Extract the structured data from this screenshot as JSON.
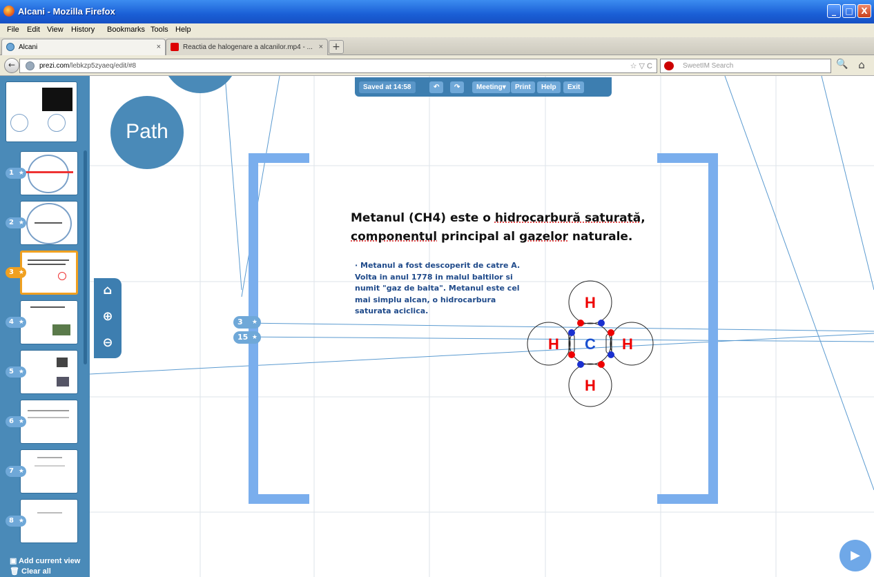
{
  "window": {
    "title": "Alcani - Mozilla Firefox",
    "min": "_",
    "max": "□",
    "close": "X"
  },
  "menu": [
    "File",
    "Edit",
    "View",
    "History",
    "Bookmarks",
    "Tools",
    "Help"
  ],
  "tabs": [
    {
      "label": "Alcani",
      "close": "×"
    },
    {
      "label": "Reactia de halogenare a alcanilor.mp4 - ...",
      "close": "×"
    }
  ],
  "newtab": "+",
  "nav": {
    "back": "←",
    "url_domain": "prezi.com",
    "url_path": "/lebkzp5zyaeq/edit/#8",
    "url_icons": "☆ ▽ C",
    "search_placeholder": "SweetIM Search",
    "search_btn": "🔍",
    "home_btn": "⌂"
  },
  "toolbar": {
    "saved": "Saved at 14:58",
    "undo": "↶",
    "redo": "↷",
    "meeting": "Meeting▾",
    "print": "Print",
    "help": "Help",
    "exit": "Exit"
  },
  "path_bubble": "Path",
  "sidebar": {
    "items": [
      {
        "num": "1",
        "star": "★"
      },
      {
        "num": "2",
        "star": "★"
      },
      {
        "num": "3",
        "star": "★",
        "active": true
      },
      {
        "num": "4",
        "star": "★"
      },
      {
        "num": "5",
        "star": "★"
      },
      {
        "num": "6",
        "star": "★"
      },
      {
        "num": "7",
        "star": "★"
      },
      {
        "num": "8",
        "star": "★"
      }
    ],
    "add_view": "Add current view",
    "clear_all": "Clear all"
  },
  "zoom": {
    "home": "⌂",
    "zoom_in": "⊕",
    "zoom_out": "⊖"
  },
  "path_marks": [
    {
      "num": "3",
      "star": "★"
    },
    {
      "num": "15",
      "star": "★"
    }
  ],
  "slide": {
    "heading_pre": "Metanul (CH4) este o ",
    "heading_u1": "hidrocarbură saturată",
    "heading_mid": ",",
    "heading_u2": "componentul",
    "heading_mid2": " principal al ",
    "heading_u3": "gazelor",
    "heading_post": " naturale.",
    "body": "· Metanul a fost descoperit de catre A. Volta in anul 1778 in malul baltilor si numit \"gaz de balta\". Metanul este cel mai simplu alcan, o hidrocarbura saturata aciclica."
  },
  "molecule": {
    "center": "C",
    "h": "H"
  },
  "play": "▶"
}
